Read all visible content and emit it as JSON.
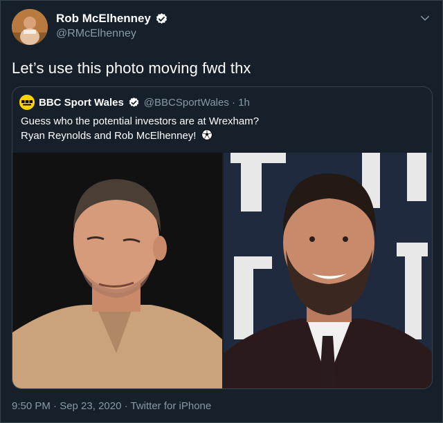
{
  "author": {
    "display_name": "Rob McElhenney",
    "handle": "@RMcElhenney",
    "verified": true
  },
  "tweet": {
    "text": "Let’s use this photo moving fwd thx"
  },
  "quoted_tweet": {
    "display_name": "BBC Sport Wales",
    "handle_time": "@BBCSportWales · 1h",
    "verified": true,
    "text_line1": "Guess who the potential investors are at Wrexham?",
    "text_line2": "Ryan Reynolds and Rob McElhenney!",
    "emoji_icon": "soccer-ball-icon",
    "photos": [
      {
        "name": "photo-ryan-reynolds",
        "background": "#0b0b0b",
        "shirt": "#caa27c"
      },
      {
        "name": "photo-rob-mcelhenney",
        "background": "#1f2a3f",
        "shirt": "#2a1718"
      }
    ]
  },
  "footer": {
    "meta": "9:50 PM · Sep 23, 2020 · Twitter for iPhone"
  },
  "colors": {
    "background": "#15202b",
    "border": "#38444d",
    "secondary_text": "#8899a6",
    "verified_blue": "#1da1f2"
  }
}
